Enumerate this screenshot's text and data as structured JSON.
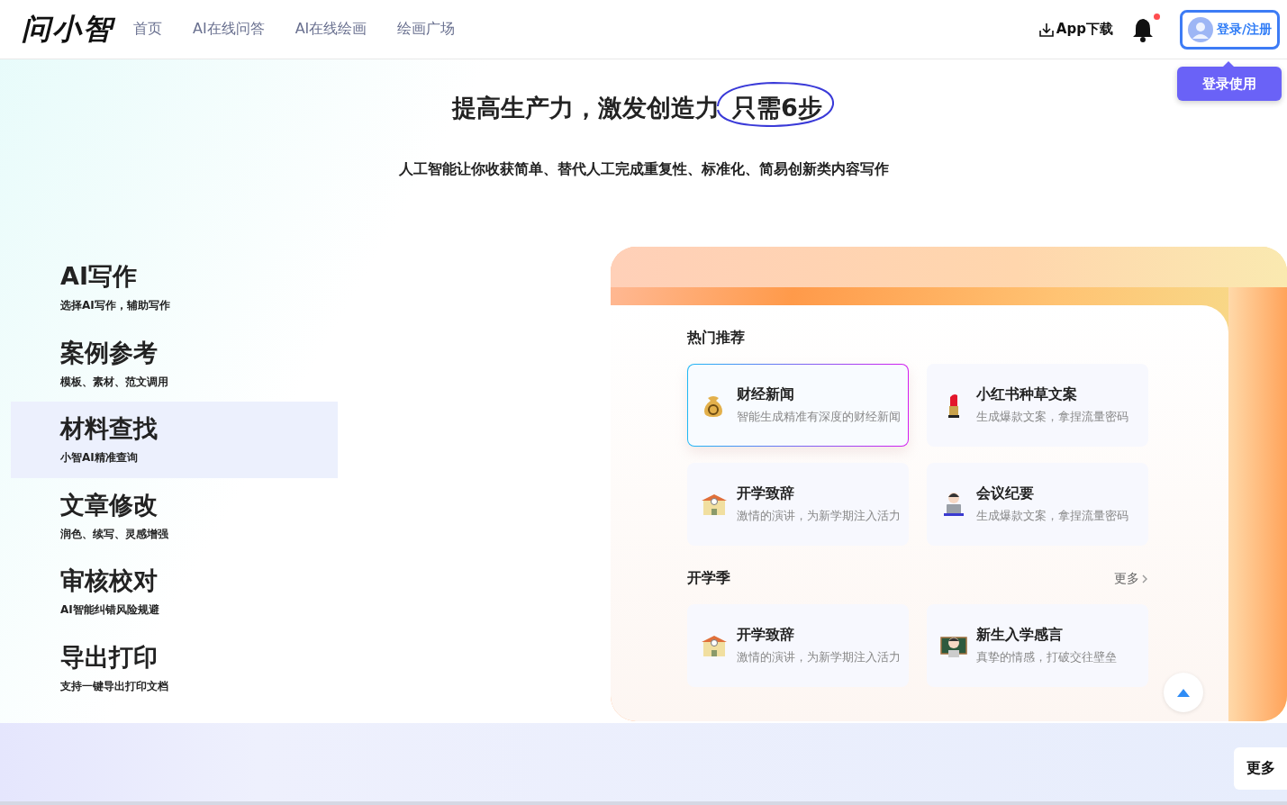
{
  "header": {
    "logo": "问小智",
    "nav": [
      {
        "label": "首页"
      },
      {
        "label": "AI在线问答"
      },
      {
        "label": "AI在线绘画"
      },
      {
        "label": "绘画广场"
      }
    ],
    "download": "App下载",
    "notification_dot": true,
    "login": "登录/注册",
    "login_tooltip": "登录使用"
  },
  "hero": {
    "title": "提高生产力，激发创造力",
    "highlight": "只需6步",
    "subtitle": "人工智能让你收获简单、替代人工完成重复性、标准化、简易创新类内容写作"
  },
  "features": [
    {
      "title": "AI写作",
      "desc": "选择AI写作，辅助写作",
      "selected": false
    },
    {
      "title": "案例参考",
      "desc": "模板、素材、范文调用",
      "selected": false
    },
    {
      "title": "材料查找",
      "desc": "小智AI精准查询",
      "selected": true
    },
    {
      "title": "文章修改",
      "desc": "润色、续写、灵感增强",
      "selected": false
    },
    {
      "title": "审核校对",
      "desc": "AI智能纠错风险规避",
      "selected": false
    },
    {
      "title": "导出打印",
      "desc": "支持一键导出打印文档",
      "selected": false
    }
  ],
  "sections": [
    {
      "title": "热门推荐",
      "cards": [
        {
          "kind": "money",
          "title": "财经新闻",
          "desc": "智能生成精准有深度的财经新闻",
          "selected": true
        },
        {
          "kind": "lipstick",
          "title": "小红书种草文案",
          "desc": "生成爆款文案，拿捏流量密码",
          "selected": false
        },
        {
          "kind": "school",
          "title": "开学致辞",
          "desc": "激情的演讲，为新学期注入活力",
          "selected": false
        },
        {
          "kind": "laptop",
          "title": "会议纪要",
          "desc": "生成爆款文案，拿捏流量密码",
          "selected": false
        }
      ]
    },
    {
      "title": "开学季",
      "more": "更多",
      "cards": [
        {
          "kind": "school",
          "title": "开学致辞",
          "desc": "激情的演讲，为新学期注入活力",
          "selected": false
        },
        {
          "kind": "teacher",
          "title": "新生入学感言",
          "desc": "真挚的情感，打破交往壁垒",
          "selected": false
        }
      ]
    }
  ],
  "side_more": "更多"
}
